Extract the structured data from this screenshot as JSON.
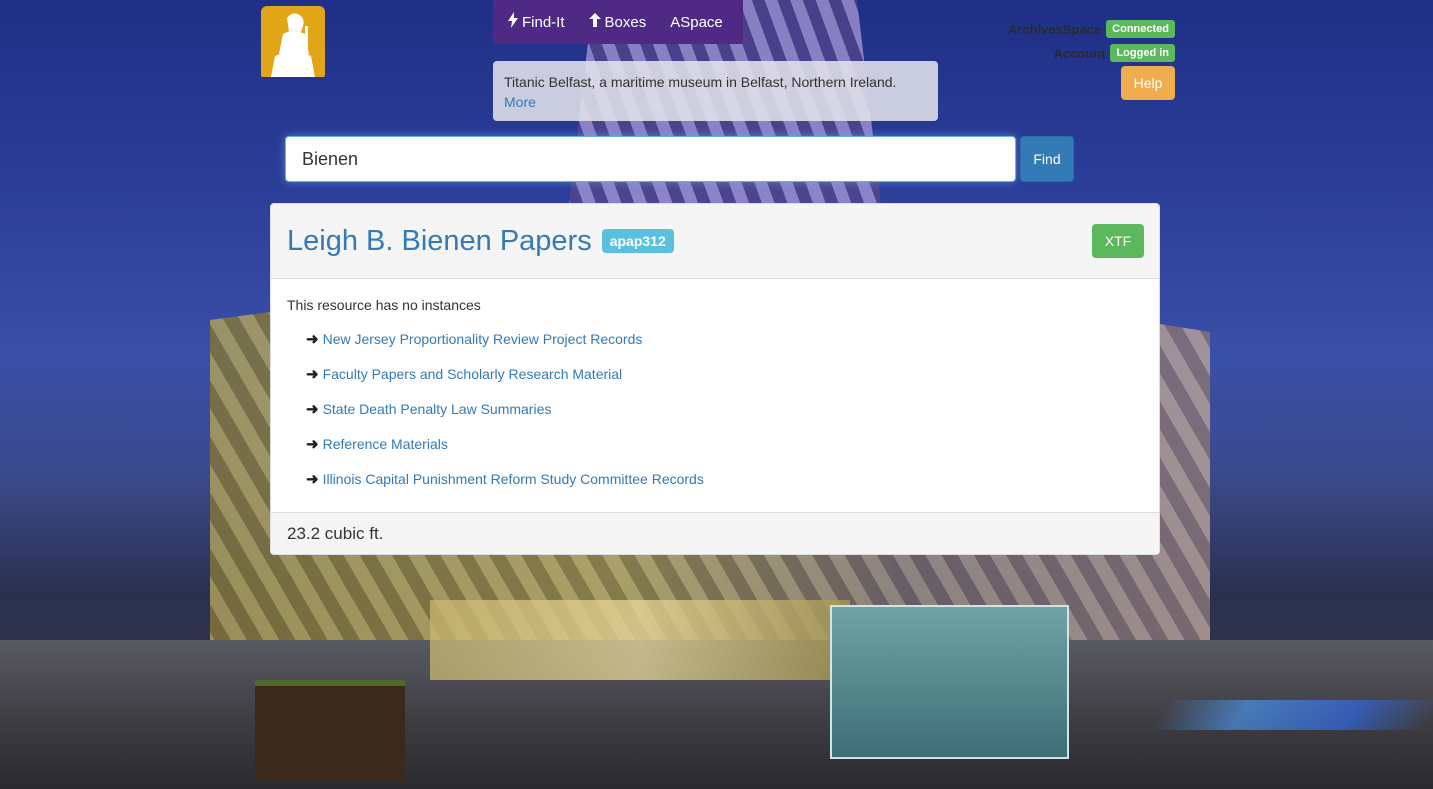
{
  "nav": {
    "items": [
      {
        "label": "Find-It",
        "icon": "flash-icon"
      },
      {
        "label": "Boxes",
        "icon": "arrow-up-icon"
      },
      {
        "label": "ASpace",
        "icon": ""
      }
    ]
  },
  "caption": {
    "text": "Titanic Belfast, a maritime museum in Belfast, Northern Ireland.",
    "more_label": "More"
  },
  "status": {
    "archivesspace_label": "ArchivesSpace",
    "archivesspace_badge": "Connected",
    "account_label": "Account",
    "account_badge": "Logged in",
    "help_label": "Help"
  },
  "search": {
    "value": "Bienen",
    "find_label": "Find"
  },
  "result": {
    "title": "Leigh B. Bienen Papers",
    "id_badge": "apap312",
    "xtf_label": "XTF",
    "no_instances": "This resource has no instances",
    "series": [
      "New Jersey Proportionality Review Project Records",
      "Faculty Papers and Scholarly Research Material",
      "State Death Penalty Law Summaries",
      "Reference Materials",
      "Illinois Capital Punishment Reform Study Committee Records"
    ],
    "extent": "23.2 cubic ft."
  },
  "colors": {
    "nav_bg": "#4e2a84",
    "link": "#337ab7",
    "success": "#5cb85c",
    "warning": "#f0ad4e",
    "info": "#5bc0de",
    "logo": "#e2a518"
  }
}
